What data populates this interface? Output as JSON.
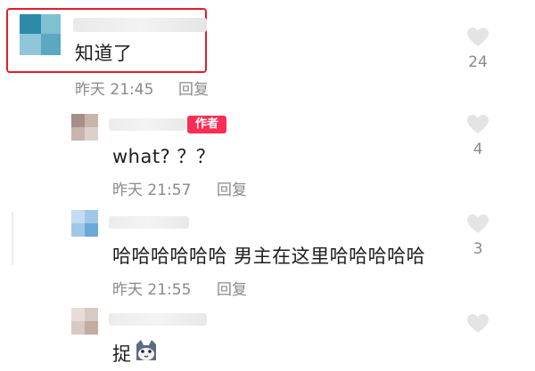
{
  "comments": [
    {
      "text": "知道了",
      "time": "昨天 21:45",
      "reply_label": "回复",
      "likes": "24",
      "highlighted": true
    },
    {
      "text": "what? ？？",
      "time": "昨天 21:57",
      "reply_label": "回复",
      "likes": "4",
      "badge": "作者"
    },
    {
      "text": "哈哈哈哈哈哈 男主在这里哈哈哈哈哈",
      "time": "昨天 21:55",
      "reply_label": "回复",
      "likes": "3"
    },
    {
      "text": "捉",
      "emoji": "cat-emoji",
      "likes": ""
    }
  ],
  "colors": {
    "highlight": "#e01e2a",
    "badge": "#fb2d55",
    "meta": "#8a8a8a"
  },
  "icons": [
    "heart-icon",
    "cat-emoji"
  ]
}
